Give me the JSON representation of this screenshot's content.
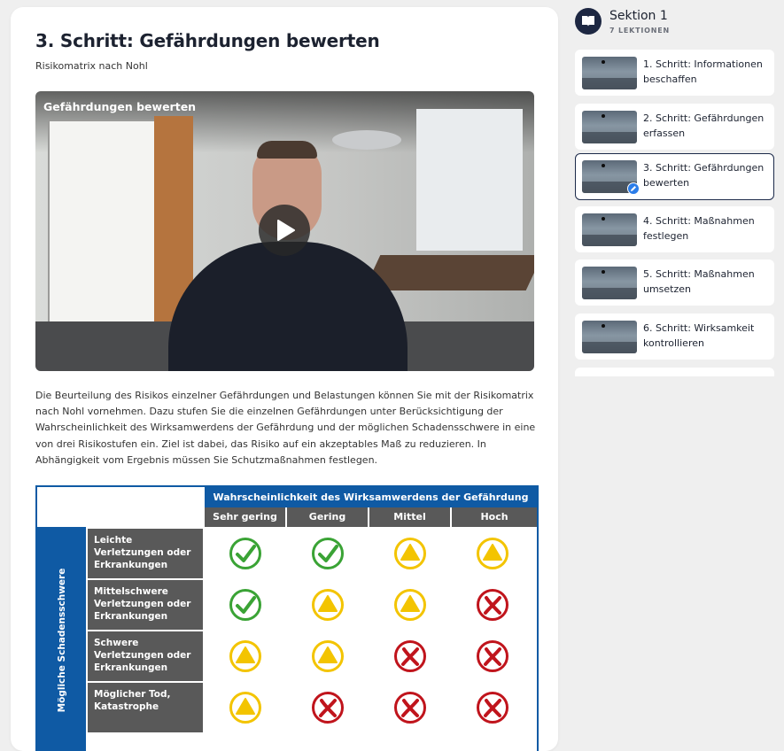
{
  "main": {
    "title": "3. Schritt: Gefährdungen bewerten",
    "subtitle": "Risikomatrix nach Nohl",
    "video": {
      "label": "Gefährdungen bewerten",
      "play_icon": "play-icon"
    },
    "description": "Die Beurteilung des Risikos einzelner Gefährdungen und Belastungen können Sie mit der Risikomatrix nach Nohl vornehmen. Dazu stufen Sie die einzelnen Gefährdungen unter Berücksichtigung der Wahrscheinlichkeit des Wirksamwerdens der Gefährdung und der möglichen Schadensschwere in eine von drei Risikostufen ein. Ziel ist dabei, das Risiko auf ein akzeptables Maß zu reduzieren. In Abhängigkeit vom Ergebnis müssen Sie Schutzmaßnahmen festlegen.",
    "matrix": {
      "header": "Wahrscheinlichkeit des Wirksamwerdens der Gefährdung",
      "side_label": "Mögliche Schadensschwere",
      "columns": [
        "Sehr gering",
        "Gering",
        "Mittel",
        "Hoch"
      ],
      "rows": [
        {
          "label": "Leichte Verletzungen oder Erkrankungen",
          "cells": [
            "check",
            "check",
            "warn",
            "warn"
          ]
        },
        {
          "label": "Mittelschwere Verletzungen oder Erkrankungen",
          "cells": [
            "check",
            "warn",
            "warn",
            "cross"
          ]
        },
        {
          "label": "Schwere Verletzungen oder Erkrankungen",
          "cells": [
            "warn",
            "warn",
            "cross",
            "cross"
          ]
        },
        {
          "label": "Möglicher Tod, Katastrophe",
          "cells": [
            "warn",
            "cross",
            "cross",
            "cross"
          ]
        }
      ],
      "colors": {
        "blue": "#0f5aa4",
        "header_gray": "#595959",
        "green": "#3aa335",
        "yellow": "#f3c400",
        "red": "#c0141c"
      }
    }
  },
  "sidebar": {
    "section_title": "Sektion 1",
    "section_sub": "7 LEKTIONEN",
    "section_icon": "book-icon",
    "lessons": [
      {
        "label": "1. Schritt: Informationen beschaffen",
        "active": false
      },
      {
        "label": "2. Schritt: Gefährdungen erfassen",
        "active": false
      },
      {
        "label": "3. Schritt: Gefährdungen bewerten",
        "active": true
      },
      {
        "label": "4. Schritt: Maßnahmen festlegen",
        "active": false
      },
      {
        "label": "5. Schritt: Maßnahmen umsetzen",
        "active": false
      },
      {
        "label": "6. Schritt: Wirksamkeit kontrollieren",
        "active": false
      }
    ],
    "accent": "#1c2a4a"
  }
}
